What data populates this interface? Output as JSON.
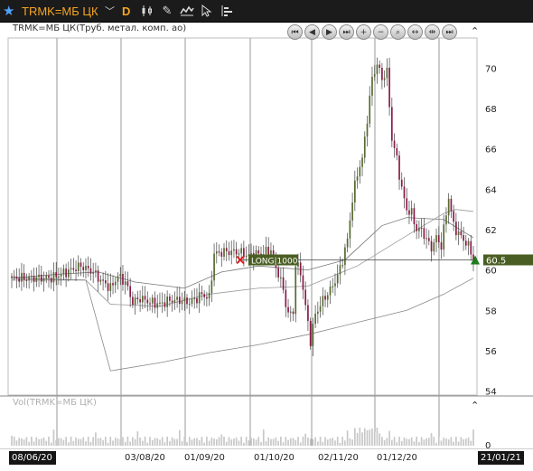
{
  "toolbar": {
    "symbol": "TRMK=МБ ЦК",
    "period": "D",
    "star_icon": "star-icon",
    "tools": [
      "candlestick-icon",
      "pencil-icon",
      "indicator-icon",
      "cursor-icon",
      "bars-layout-icon"
    ]
  },
  "chart_title": "TRMK=МБ ЦК(Труб. метал. комп. ао)",
  "volume_title": "Vol(TRMK=МБ ЦК)",
  "nav_buttons": [
    "first",
    "back",
    "play",
    "forward",
    "zoom-in",
    "zoom-out",
    "zoom-fit",
    "horizontal-expand",
    "horizontal-fit",
    "last"
  ],
  "colors": {
    "up": "#556b2f",
    "down": "#8b1a4a",
    "price_label": "#4a5e23",
    "grid": "#9a9a9a"
  },
  "order_marker": {
    "label": "LONG|1000",
    "price": 60.5
  },
  "last_price": {
    "value": 60.5,
    "label": "60.5"
  },
  "footer": {
    "start_date": "08/06/20",
    "end_date": "21/01/21",
    "date_labels": [
      "03/08/20",
      "01/09/20",
      "01/10/20",
      "02/11/20",
      "01/12/20"
    ]
  },
  "chart_data": {
    "type": "candlestick",
    "ylim": [
      53.8,
      71.5
    ],
    "y_ticks": [
      54,
      56,
      58,
      60,
      62,
      64,
      66,
      68,
      70
    ],
    "volume_ticks": [
      0
    ],
    "anchors": [
      [
        0,
        59.6
      ],
      [
        16,
        59.6
      ],
      [
        28,
        60.2
      ],
      [
        33,
        59.9
      ],
      [
        36,
        59.5
      ],
      [
        40,
        59.1
      ],
      [
        43,
        59.7
      ],
      [
        46,
        59.4
      ],
      [
        49,
        58.4
      ],
      [
        52,
        58.6
      ],
      [
        56,
        58.4
      ],
      [
        60,
        58.3
      ],
      [
        64,
        58.5
      ],
      [
        68,
        58.5
      ],
      [
        72,
        58.4
      ],
      [
        75,
        58.6
      ],
      [
        77,
        58.8
      ],
      [
        80,
        58.6
      ],
      [
        82,
        60.8
      ],
      [
        86,
        60.9
      ],
      [
        92,
        60.9
      ],
      [
        96,
        60.7
      ],
      [
        100,
        60.8
      ],
      [
        103,
        60.9
      ],
      [
        105,
        61.0
      ],
      [
        107,
        60.1
      ],
      [
        109,
        59.5
      ],
      [
        112,
        57.8
      ],
      [
        114,
        57.9
      ],
      [
        115,
        60.3
      ],
      [
        117,
        59.9
      ],
      [
        119,
        58.2
      ],
      [
        121,
        56.5
      ],
      [
        123,
        57.8
      ],
      [
        126,
        58.5
      ],
      [
        129,
        59.0
      ],
      [
        132,
        59.7
      ],
      [
        134,
        60.5
      ],
      [
        136,
        61.5
      ],
      [
        138,
        63.5
      ],
      [
        140,
        64.8
      ],
      [
        142,
        65.5
      ],
      [
        144,
        67.5
      ],
      [
        146,
        69.5
      ],
      [
        148,
        70.2
      ],
      [
        150,
        69.5
      ],
      [
        152,
        69.8
      ],
      [
        154,
        66.5
      ],
      [
        156,
        65.5
      ],
      [
        158,
        64.0
      ],
      [
        160,
        63.0
      ],
      [
        162,
        62.8
      ],
      [
        164,
        62.0
      ],
      [
        166,
        62.0
      ],
      [
        168,
        61.5
      ],
      [
        170,
        61.1
      ],
      [
        172,
        61.6
      ],
      [
        174,
        61.2
      ],
      [
        176,
        62.8
      ],
      [
        177,
        63.6
      ],
      [
        179,
        62.2
      ],
      [
        181,
        61.8
      ],
      [
        183,
        61.5
      ],
      [
        185,
        61.2
      ],
      [
        187,
        60.5
      ]
    ],
    "ma_fast": [
      [
        0,
        59.6
      ],
      [
        20,
        59.8
      ],
      [
        35,
        59.9
      ],
      [
        50,
        59.4
      ],
      [
        70,
        59.1
      ],
      [
        85,
        59.9
      ],
      [
        100,
        60.2
      ],
      [
        120,
        60.0
      ],
      [
        135,
        60.5
      ],
      [
        150,
        62.2
      ],
      [
        160,
        62.6
      ],
      [
        175,
        62.5
      ],
      [
        187,
        61.6
      ]
    ],
    "ma_slow": [
      [
        0,
        59.6
      ],
      [
        30,
        59.5
      ],
      [
        40,
        55.0
      ],
      [
        60,
        55.4
      ],
      [
        80,
        55.9
      ],
      [
        100,
        56.3
      ],
      [
        120,
        56.8
      ],
      [
        140,
        57.4
      ],
      [
        160,
        58.0
      ],
      [
        175,
        58.8
      ],
      [
        187,
        59.6
      ]
    ],
    "ma_mid": [
      [
        0,
        59.5
      ],
      [
        30,
        59.5
      ],
      [
        40,
        58.3
      ],
      [
        60,
        58.2
      ],
      [
        80,
        58.8
      ],
      [
        100,
        59.1
      ],
      [
        120,
        59.2
      ],
      [
        140,
        60.2
      ],
      [
        160,
        61.7
      ],
      [
        175,
        62.8
      ],
      [
        180,
        63.0
      ],
      [
        187,
        62.9
      ]
    ]
  }
}
